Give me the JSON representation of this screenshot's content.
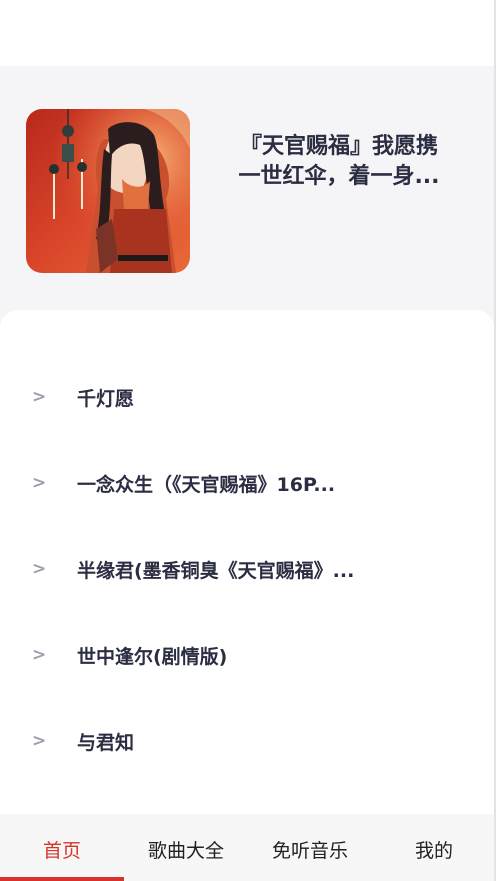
{
  "playlist": {
    "title_line1": "『天官赐福』我愿携",
    "title_line2": "一世红伞，着一身..."
  },
  "songs": [
    {
      "chevron": ">",
      "name": "千灯愿"
    },
    {
      "chevron": ">",
      "name": "一念众生（《天官赐福》16P..."
    },
    {
      "chevron": ">",
      "name": "半缘君(墨香铜臭《天官赐福》..."
    },
    {
      "chevron": ">",
      "name": "世中逢尔(剧情版)"
    },
    {
      "chevron": ">",
      "name": "与君知"
    }
  ],
  "tabs": [
    {
      "label": "首页",
      "active": true
    },
    {
      "label": "歌曲大全",
      "active": false
    },
    {
      "label": "免听音乐",
      "active": false
    },
    {
      "label": "我的",
      "active": false
    }
  ],
  "colors": {
    "accent": "#d8332b",
    "text_dark": "#2b2d42",
    "chevron": "#9aa0ad",
    "hero_bg": "#f5f5f7"
  }
}
